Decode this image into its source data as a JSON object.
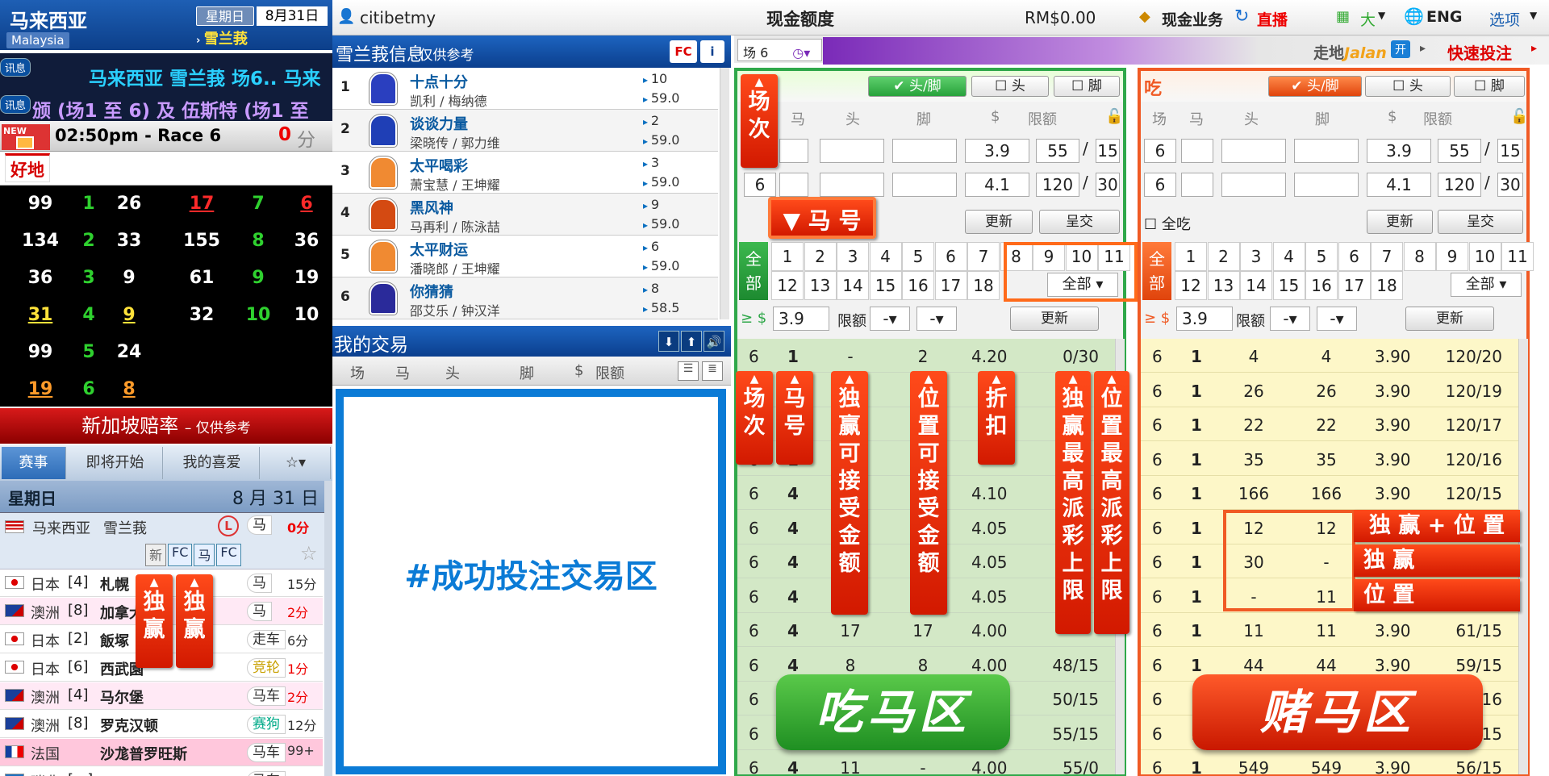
{
  "left": {
    "title": "马来西亚",
    "subtitle": "Malaysia",
    "weekday": "星期日",
    "date": "8月31日",
    "venue": "雪兰莪",
    "ticker1_badge": "讯息",
    "ticker1": "马来西亚 雪兰莪 场6.. 马来",
    "ticker2_badge": "讯息",
    "ticker2": "颁 (场1 至 6) 及 伍斯特 (场1 至",
    "new_label": "NEW",
    "race_time": "02:50pm - Race 6",
    "countdown_value": "0",
    "countdown_unit": "分钟",
    "going": "好地",
    "numbers": [
      [
        "99",
        "1",
        "26",
        "17",
        "7",
        "6"
      ],
      [
        "134",
        "2",
        "33",
        "155",
        "8",
        "36"
      ],
      [
        "36",
        "3",
        "9",
        "61",
        "9",
        "19"
      ],
      [
        "31",
        "4",
        "9",
        "32",
        "10",
        "10"
      ],
      [
        "99",
        "5",
        "24",
        "",
        "",
        ""
      ],
      [
        "19",
        "6",
        "8",
        "",
        "",
        ""
      ]
    ],
    "sg_odds": "新加坡赔率",
    "sg_odds_note": "– 仅供参考",
    "tabs": [
      "赛事",
      "即将开始",
      "我的喜爱"
    ],
    "day_label": "星期日",
    "day_date": "8 月 31 日",
    "featured_country": "马来西亚",
    "featured_venue": "雪兰莪",
    "featured_type": "马",
    "featured_time": "0分",
    "featured_tags": [
      "新",
      "FC",
      "马",
      "FC"
    ],
    "races": [
      {
        "country": "日本",
        "code": "[4]",
        "name": "札幌",
        "type": "马",
        "time": "15分"
      },
      {
        "country": "澳洲",
        "code": "[8]",
        "name": "加拿大",
        "type": "马",
        "time": "2分"
      },
      {
        "country": "日本",
        "code": "[2]",
        "name": "飯塚",
        "type": "走车",
        "time": "6分"
      },
      {
        "country": "日本",
        "code": "[6]",
        "name": "西武園",
        "type": "竞轮",
        "time": "1分"
      },
      {
        "country": "澳洲",
        "code": "[4]",
        "name": "马尔堡",
        "type": "马车",
        "time": "2分"
      },
      {
        "country": "澳洲",
        "code": "[8]",
        "name": "罗克汉顿",
        "type": "赛狗",
        "time": "12分"
      },
      {
        "country": "法国",
        "code": "",
        "name": "沙尨普罗旺斯",
        "type": "马车",
        "time": "99+"
      },
      {
        "country": "瑞典",
        "code": "[...]",
        "name": "...",
        "type": "马车",
        "time": ""
      }
    ]
  },
  "top": {
    "user": "citibetmy",
    "credit_label": "现金额度",
    "credit_value": "RM$0.00",
    "cash_business": "现金业务",
    "live": "直播",
    "size": "大",
    "lang": "ENG",
    "options": "选项"
  },
  "info": {
    "title": "雪兰莪信息",
    "note": "- 仅供参考",
    "fc": "FC",
    "runners": [
      {
        "no": "1",
        "name": "十点十分",
        "jockey": "凯利 / 梅纳德",
        "draw": "10",
        "weight": "59.0",
        "color": "#2a3fbf"
      },
      {
        "no": "2",
        "name": "谈谈力量",
        "jockey": "梁晓传 / 郭力维",
        "draw": "2",
        "weight": "59.0",
        "color": "#1f3fb6"
      },
      {
        "no": "3",
        "name": "太平喝彩",
        "jockey": "萧宝慧 / 王坤耀",
        "draw": "3",
        "weight": "59.0",
        "color": "#f08a32"
      },
      {
        "no": "4",
        "name": "黑风神",
        "jockey": "马再利 / 陈泳喆",
        "draw": "9",
        "weight": "59.0",
        "color": "#d44a12"
      },
      {
        "no": "5",
        "name": "太平财运",
        "jockey": "潘晓郎 / 王坤耀",
        "draw": "6",
        "weight": "59.0",
        "color": "#f08a32"
      },
      {
        "no": "6",
        "name": "你猜猜",
        "jockey": "邵艾乐 / 钟汉洋",
        "draw": "8",
        "weight": "58.5",
        "color": "#2a2a9a"
      }
    ]
  },
  "mytrade": {
    "title": "我的交易",
    "cols": [
      "场",
      "马",
      "头",
      "脚",
      "$",
      "限额"
    ],
    "area_text": "#成功投注交易区"
  },
  "race_select": "场 6",
  "purple": {
    "walk": "走地",
    "jalan": "Jalan",
    "open": "开",
    "quick_bet": "快速投注"
  },
  "eat": {
    "title": "吃",
    "checks": [
      "头/脚",
      "头",
      "脚"
    ],
    "cols": [
      "场",
      "马",
      "头",
      "脚",
      "$",
      "限额"
    ],
    "rows": [
      {
        "race": "6",
        "horse": "",
        "win": "",
        "place": "",
        "rate": "3.9",
        "limit1": "55",
        "limit2": "15"
      },
      {
        "race": "6",
        "horse": "",
        "win": "",
        "place": "",
        "rate": "4.1",
        "limit1": "120",
        "limit2": "30"
      }
    ],
    "update": "更新",
    "submit": "呈交",
    "all": "全部",
    "nums1": [
      "1",
      "2",
      "3",
      "4",
      "5",
      "6",
      "7",
      "8",
      "9",
      "10",
      "11"
    ],
    "nums2": [
      "12",
      "13",
      "14",
      "15",
      "16",
      "17",
      "18"
    ],
    "all_select": "全部",
    "filter_gte": "≥ $",
    "filter_rate": "3.9",
    "filter_limit": "限额",
    "list": [
      [
        "6",
        "1",
        "-",
        "2",
        "4.20",
        "0/30"
      ],
      [
        "6",
        "1",
        "",
        "",
        "",
        ""
      ],
      [
        "6",
        "1",
        "",
        "",
        "",
        ""
      ],
      [
        "6",
        "1",
        "",
        "",
        "",
        ""
      ],
      [
        "6",
        "4",
        "",
        "",
        "4.10",
        ""
      ],
      [
        "6",
        "4",
        "",
        "",
        "4.05",
        ""
      ],
      [
        "6",
        "4",
        "",
        "",
        "4.05",
        ""
      ],
      [
        "6",
        "4",
        "",
        "",
        "4.05",
        ""
      ],
      [
        "6",
        "4",
        "17",
        "17",
        "4.00",
        ""
      ],
      [
        "6",
        "4",
        "8",
        "8",
        "4.00",
        "48/15"
      ],
      [
        "6",
        "4",
        "",
        "",
        "",
        "50/15"
      ],
      [
        "6",
        "4",
        "",
        "",
        "",
        "55/15"
      ],
      [
        "6",
        "4",
        "11",
        "-",
        "4.00",
        "55/0"
      ]
    ],
    "big_label": "吃马区"
  },
  "bet": {
    "title": "吃",
    "checks": [
      "头/脚",
      "头",
      "脚"
    ],
    "cols": [
      "场",
      "马",
      "头",
      "脚",
      "$",
      "限额"
    ],
    "rows": [
      {
        "race": "6",
        "horse": "",
        "win": "",
        "place": "",
        "rate": "3.9",
        "limit1": "55",
        "limit2": "15"
      },
      {
        "race": "6",
        "horse": "",
        "win": "",
        "place": "",
        "rate": "4.1",
        "limit1": "120",
        "limit2": "30"
      }
    ],
    "eat_all": "全吃",
    "update": "更新",
    "submit": "呈交",
    "all": "全部",
    "nums1": [
      "1",
      "2",
      "3",
      "4",
      "5",
      "6",
      "7",
      "8",
      "9",
      "10",
      "11"
    ],
    "nums2": [
      "12",
      "13",
      "14",
      "15",
      "16",
      "17",
      "18"
    ],
    "all_select": "全部",
    "filter_gte": "≥ $",
    "filter_rate": "3.9",
    "filter_limit": "限额",
    "list": [
      [
        "6",
        "1",
        "4",
        "4",
        "3.90",
        "120/20"
      ],
      [
        "6",
        "1",
        "26",
        "26",
        "3.90",
        "120/19"
      ],
      [
        "6",
        "1",
        "22",
        "22",
        "3.90",
        "120/17"
      ],
      [
        "6",
        "1",
        "35",
        "35",
        "3.90",
        "120/16"
      ],
      [
        "6",
        "1",
        "166",
        "166",
        "3.90",
        "120/15"
      ],
      [
        "6",
        "1",
        "12",
        "12",
        "",
        ""
      ],
      [
        "6",
        "1",
        "30",
        "-",
        "",
        ""
      ],
      [
        "6",
        "1",
        "-",
        "11",
        "",
        ""
      ],
      [
        "6",
        "1",
        "11",
        "11",
        "3.90",
        "61/15"
      ],
      [
        "6",
        "1",
        "44",
        "44",
        "3.90",
        "59/15"
      ],
      [
        "6",
        "1",
        "",
        "",
        "",
        "7/16"
      ],
      [
        "6",
        "1",
        "",
        "",
        "",
        "7/15"
      ],
      [
        "6",
        "1",
        "549",
        "549",
        "3.90",
        "56/15"
      ]
    ],
    "big_label": "赌马区"
  },
  "annotations": {
    "race_no": "场次",
    "horse_no": "马号",
    "horse_no_tag": "马 号",
    "win_accept": "独赢可接受金额",
    "place_accept": "位置可接受金额",
    "discount": "折扣",
    "win_max": "独赢最高派彩上限",
    "place_max": "位置最高派彩上限",
    "win_place": "独 赢 + 位 置",
    "win": "独 赢",
    "place": "位 置",
    "left_win1": "独赢",
    "left_win2": "独赢"
  },
  "colors": {
    "eat_border": "#2fa84a",
    "bet_border": "#f05a24",
    "trade_border": "#0b7bd6",
    "accent_red": "#e60000"
  }
}
